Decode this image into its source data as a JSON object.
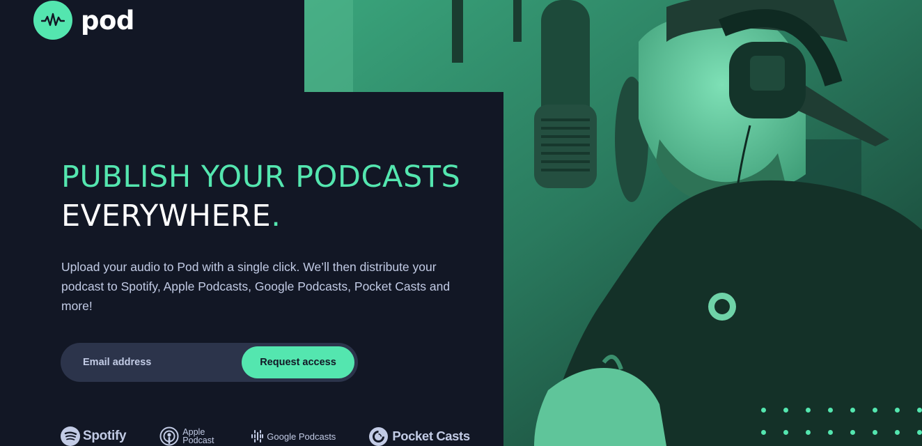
{
  "brand": {
    "name": "pod",
    "accent": "#54e6af",
    "background": "#121725",
    "logo_icon": "waveform-icon"
  },
  "hero": {
    "headline_line1": "PUBLISH YOUR PODCASTS",
    "headline_line2": "EVERYWHERE",
    "headline_dot": ".",
    "description": "Upload your audio to Pod with a single click. We’ll then distribute your podcast to Spotify, Apple Podcasts, Google Podcasts, Pocket Casts and more!",
    "photo_subject": "podcaster-at-microphone-image"
  },
  "form": {
    "email_placeholder": "Email address",
    "email_value": "",
    "submit_label": "Request access"
  },
  "platforms": [
    {
      "name": "Spotify",
      "icon": "spotify-icon"
    },
    {
      "name": "Apple Podcast",
      "icon": "apple-podcast-icon"
    },
    {
      "name": "Google Podcasts",
      "icon": "google-podcasts-icon"
    },
    {
      "name": "Pocket Casts",
      "icon": "pocket-casts-icon"
    }
  ]
}
